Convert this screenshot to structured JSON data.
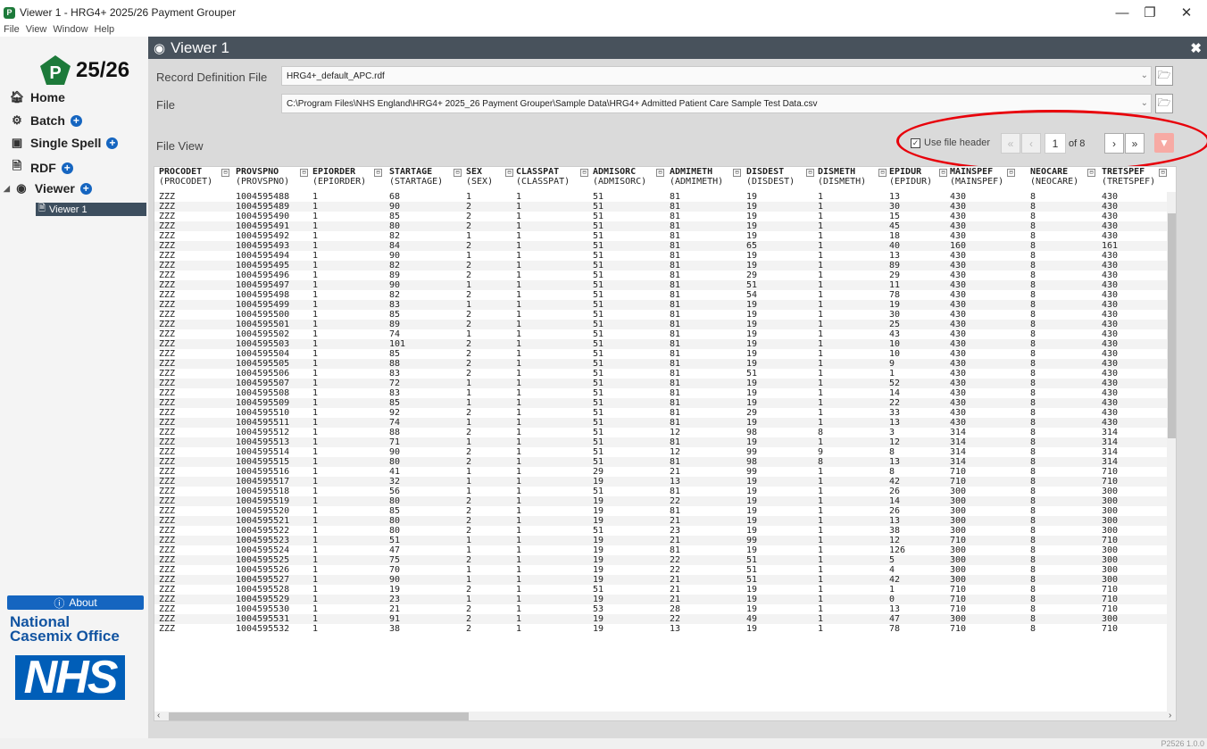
{
  "window": {
    "title": "Viewer 1 - HRG4+ 2025/26 Payment Grouper",
    "menu": [
      "File",
      "View",
      "Window",
      "Help"
    ]
  },
  "sidebar": {
    "logo_letter": "P",
    "logo_year": "25/26",
    "nav": [
      {
        "label": "Home",
        "icon": "home-icon"
      },
      {
        "label": "Batch",
        "icon": "batch-icon"
      },
      {
        "label": "Single Spell",
        "icon": "cube-icon"
      },
      {
        "label": "RDF",
        "icon": "document-icon"
      },
      {
        "label": "Viewer",
        "icon": "eye-icon"
      }
    ],
    "viewer_child": "Viewer 1",
    "about_label": "About",
    "office_line1": "National",
    "office_line2": "Casemix Office",
    "nhs": "NHS"
  },
  "panel": {
    "title": "Viewer 1",
    "rdf_label": "Record Definition File",
    "rdf_value": "HRG4+_default_APC.rdf",
    "file_label": "File",
    "file_value": "C:\\Program Files\\NHS England\\HRG4+ 2025_26 Payment Grouper\\Sample Data\\HRG4+ Admitted Patient Care Sample Test Data.csv",
    "fileview_label": "File View",
    "use_header_label": "Use file header",
    "use_header_checked": true,
    "page_current": "1",
    "page_of": "of 8"
  },
  "table": {
    "columns": [
      {
        "name": "PROCODET",
        "sub": "(PROCODET)"
      },
      {
        "name": "PROVSPNO",
        "sub": "(PROVSPNO)"
      },
      {
        "name": "EPIORDER",
        "sub": "(EPIORDER)"
      },
      {
        "name": "STARTAGE",
        "sub": "(STARTAGE)"
      },
      {
        "name": "SEX",
        "sub": "(SEX)"
      },
      {
        "name": "CLASSPAT",
        "sub": "(CLASSPAT)"
      },
      {
        "name": "ADMISORC",
        "sub": "(ADMISORC)"
      },
      {
        "name": "ADMIMETH",
        "sub": "(ADMIMETH)"
      },
      {
        "name": "DISDEST",
        "sub": "(DISDEST)"
      },
      {
        "name": "DISMETH",
        "sub": "(DISMETH)"
      },
      {
        "name": "EPIDUR",
        "sub": "(EPIDUR)"
      },
      {
        "name": "MAINSPEF",
        "sub": "(MAINSPEF)"
      },
      {
        "name": "NEOCARE",
        "sub": "(NEOCARE)"
      },
      {
        "name": "TRETSPEF",
        "sub": "(TRETSPEF)"
      }
    ],
    "rows": [
      [
        "ZZZ",
        "1004595488",
        "1",
        "68",
        "1",
        "1",
        "51",
        "81",
        "19",
        "1",
        "13",
        "430",
        "8",
        "430"
      ],
      [
        "ZZZ",
        "1004595489",
        "1",
        "90",
        "2",
        "1",
        "51",
        "81",
        "19",
        "1",
        "30",
        "430",
        "8",
        "430"
      ],
      [
        "ZZZ",
        "1004595490",
        "1",
        "85",
        "2",
        "1",
        "51",
        "81",
        "19",
        "1",
        "15",
        "430",
        "8",
        "430"
      ],
      [
        "ZZZ",
        "1004595491",
        "1",
        "80",
        "2",
        "1",
        "51",
        "81",
        "19",
        "1",
        "45",
        "430",
        "8",
        "430"
      ],
      [
        "ZZZ",
        "1004595492",
        "1",
        "82",
        "1",
        "1",
        "51",
        "81",
        "19",
        "1",
        "18",
        "430",
        "8",
        "430"
      ],
      [
        "ZZZ",
        "1004595493",
        "1",
        "84",
        "2",
        "1",
        "51",
        "81",
        "65",
        "1",
        "40",
        "160",
        "8",
        "161"
      ],
      [
        "ZZZ",
        "1004595494",
        "1",
        "90",
        "1",
        "1",
        "51",
        "81",
        "19",
        "1",
        "13",
        "430",
        "8",
        "430"
      ],
      [
        "ZZZ",
        "1004595495",
        "1",
        "82",
        "2",
        "1",
        "51",
        "81",
        "19",
        "1",
        "89",
        "430",
        "8",
        "430"
      ],
      [
        "ZZZ",
        "1004595496",
        "1",
        "89",
        "2",
        "1",
        "51",
        "81",
        "29",
        "1",
        "29",
        "430",
        "8",
        "430"
      ],
      [
        "ZZZ",
        "1004595497",
        "1",
        "90",
        "1",
        "1",
        "51",
        "81",
        "51",
        "1",
        "11",
        "430",
        "8",
        "430"
      ],
      [
        "ZZZ",
        "1004595498",
        "1",
        "82",
        "2",
        "1",
        "51",
        "81",
        "54",
        "1",
        "78",
        "430",
        "8",
        "430"
      ],
      [
        "ZZZ",
        "1004595499",
        "1",
        "83",
        "1",
        "1",
        "51",
        "81",
        "19",
        "1",
        "19",
        "430",
        "8",
        "430"
      ],
      [
        "ZZZ",
        "1004595500",
        "1",
        "85",
        "2",
        "1",
        "51",
        "81",
        "19",
        "1",
        "30",
        "430",
        "8",
        "430"
      ],
      [
        "ZZZ",
        "1004595501",
        "1",
        "89",
        "2",
        "1",
        "51",
        "81",
        "19",
        "1",
        "25",
        "430",
        "8",
        "430"
      ],
      [
        "ZZZ",
        "1004595502",
        "1",
        "74",
        "1",
        "1",
        "51",
        "81",
        "19",
        "1",
        "43",
        "430",
        "8",
        "430"
      ],
      [
        "ZZZ",
        "1004595503",
        "1",
        "101",
        "2",
        "1",
        "51",
        "81",
        "19",
        "1",
        "10",
        "430",
        "8",
        "430"
      ],
      [
        "ZZZ",
        "1004595504",
        "1",
        "85",
        "2",
        "1",
        "51",
        "81",
        "19",
        "1",
        "10",
        "430",
        "8",
        "430"
      ],
      [
        "ZZZ",
        "1004595505",
        "1",
        "88",
        "2",
        "1",
        "51",
        "81",
        "19",
        "1",
        "9",
        "430",
        "8",
        "430"
      ],
      [
        "ZZZ",
        "1004595506",
        "1",
        "83",
        "2",
        "1",
        "51",
        "81",
        "51",
        "1",
        "1",
        "430",
        "8",
        "430"
      ],
      [
        "ZZZ",
        "1004595507",
        "1",
        "72",
        "1",
        "1",
        "51",
        "81",
        "19",
        "1",
        "52",
        "430",
        "8",
        "430"
      ],
      [
        "ZZZ",
        "1004595508",
        "1",
        "83",
        "1",
        "1",
        "51",
        "81",
        "19",
        "1",
        "14",
        "430",
        "8",
        "430"
      ],
      [
        "ZZZ",
        "1004595509",
        "1",
        "85",
        "1",
        "1",
        "51",
        "81",
        "19",
        "1",
        "22",
        "430",
        "8",
        "430"
      ],
      [
        "ZZZ",
        "1004595510",
        "1",
        "92",
        "2",
        "1",
        "51",
        "81",
        "29",
        "1",
        "33",
        "430",
        "8",
        "430"
      ],
      [
        "ZZZ",
        "1004595511",
        "1",
        "74",
        "1",
        "1",
        "51",
        "81",
        "19",
        "1",
        "13",
        "430",
        "8",
        "430"
      ],
      [
        "ZZZ",
        "1004595512",
        "1",
        "88",
        "2",
        "1",
        "51",
        "12",
        "98",
        "8",
        "3",
        "314",
        "8",
        "314"
      ],
      [
        "ZZZ",
        "1004595513",
        "1",
        "71",
        "1",
        "1",
        "51",
        "81",
        "19",
        "1",
        "12",
        "314",
        "8",
        "314"
      ],
      [
        "ZZZ",
        "1004595514",
        "1",
        "90",
        "2",
        "1",
        "51",
        "12",
        "99",
        "9",
        "8",
        "314",
        "8",
        "314"
      ],
      [
        "ZZZ",
        "1004595515",
        "1",
        "80",
        "2",
        "1",
        "51",
        "81",
        "98",
        "8",
        "13",
        "314",
        "8",
        "314"
      ],
      [
        "ZZZ",
        "1004595516",
        "1",
        "41",
        "1",
        "1",
        "29",
        "21",
        "99",
        "1",
        "8",
        "710",
        "8",
        "710"
      ],
      [
        "ZZZ",
        "1004595517",
        "1",
        "32",
        "1",
        "1",
        "19",
        "13",
        "19",
        "1",
        "42",
        "710",
        "8",
        "710"
      ],
      [
        "ZZZ",
        "1004595518",
        "1",
        "56",
        "1",
        "1",
        "51",
        "81",
        "19",
        "1",
        "26",
        "300",
        "8",
        "300"
      ],
      [
        "ZZZ",
        "1004595519",
        "1",
        "80",
        "2",
        "1",
        "19",
        "22",
        "19",
        "1",
        "14",
        "300",
        "8",
        "300"
      ],
      [
        "ZZZ",
        "1004595520",
        "1",
        "85",
        "2",
        "1",
        "19",
        "81",
        "19",
        "1",
        "26",
        "300",
        "8",
        "300"
      ],
      [
        "ZZZ",
        "1004595521",
        "1",
        "80",
        "2",
        "1",
        "19",
        "21",
        "19",
        "1",
        "13",
        "300",
        "8",
        "300"
      ],
      [
        "ZZZ",
        "1004595522",
        "1",
        "80",
        "2",
        "1",
        "51",
        "23",
        "19",
        "1",
        "38",
        "300",
        "8",
        "300"
      ],
      [
        "ZZZ",
        "1004595523",
        "1",
        "51",
        "1",
        "1",
        "19",
        "21",
        "99",
        "1",
        "12",
        "710",
        "8",
        "710"
      ],
      [
        "ZZZ",
        "1004595524",
        "1",
        "47",
        "1",
        "1",
        "19",
        "81",
        "19",
        "1",
        "126",
        "300",
        "8",
        "300"
      ],
      [
        "ZZZ",
        "1004595525",
        "1",
        "75",
        "2",
        "1",
        "19",
        "22",
        "51",
        "1",
        "5",
        "300",
        "8",
        "300"
      ],
      [
        "ZZZ",
        "1004595526",
        "1",
        "70",
        "1",
        "1",
        "19",
        "22",
        "51",
        "1",
        "4",
        "300",
        "8",
        "300"
      ],
      [
        "ZZZ",
        "1004595527",
        "1",
        "90",
        "1",
        "1",
        "19",
        "21",
        "51",
        "1",
        "42",
        "300",
        "8",
        "300"
      ],
      [
        "ZZZ",
        "1004595528",
        "1",
        "19",
        "2",
        "1",
        "51",
        "21",
        "19",
        "1",
        "1",
        "710",
        "8",
        "710"
      ],
      [
        "ZZZ",
        "1004595529",
        "1",
        "23",
        "1",
        "1",
        "19",
        "21",
        "19",
        "1",
        "0",
        "710",
        "8",
        "710"
      ],
      [
        "ZZZ",
        "1004595530",
        "1",
        "21",
        "2",
        "1",
        "53",
        "28",
        "19",
        "1",
        "13",
        "710",
        "8",
        "710"
      ],
      [
        "ZZZ",
        "1004595531",
        "1",
        "91",
        "2",
        "1",
        "19",
        "22",
        "49",
        "1",
        "47",
        "300",
        "8",
        "300"
      ],
      [
        "ZZZ",
        "1004595532",
        "1",
        "38",
        "2",
        "1",
        "19",
        "13",
        "19",
        "1",
        "78",
        "710",
        "8",
        "710"
      ]
    ]
  },
  "status": {
    "build": "P2526 1.0.0"
  },
  "colors": {
    "accent": "#1565c0",
    "panel_header": "#48525c",
    "logo_green": "#1d7a3a",
    "nhs_blue": "#005eb8",
    "highlight": "#e8000a"
  }
}
